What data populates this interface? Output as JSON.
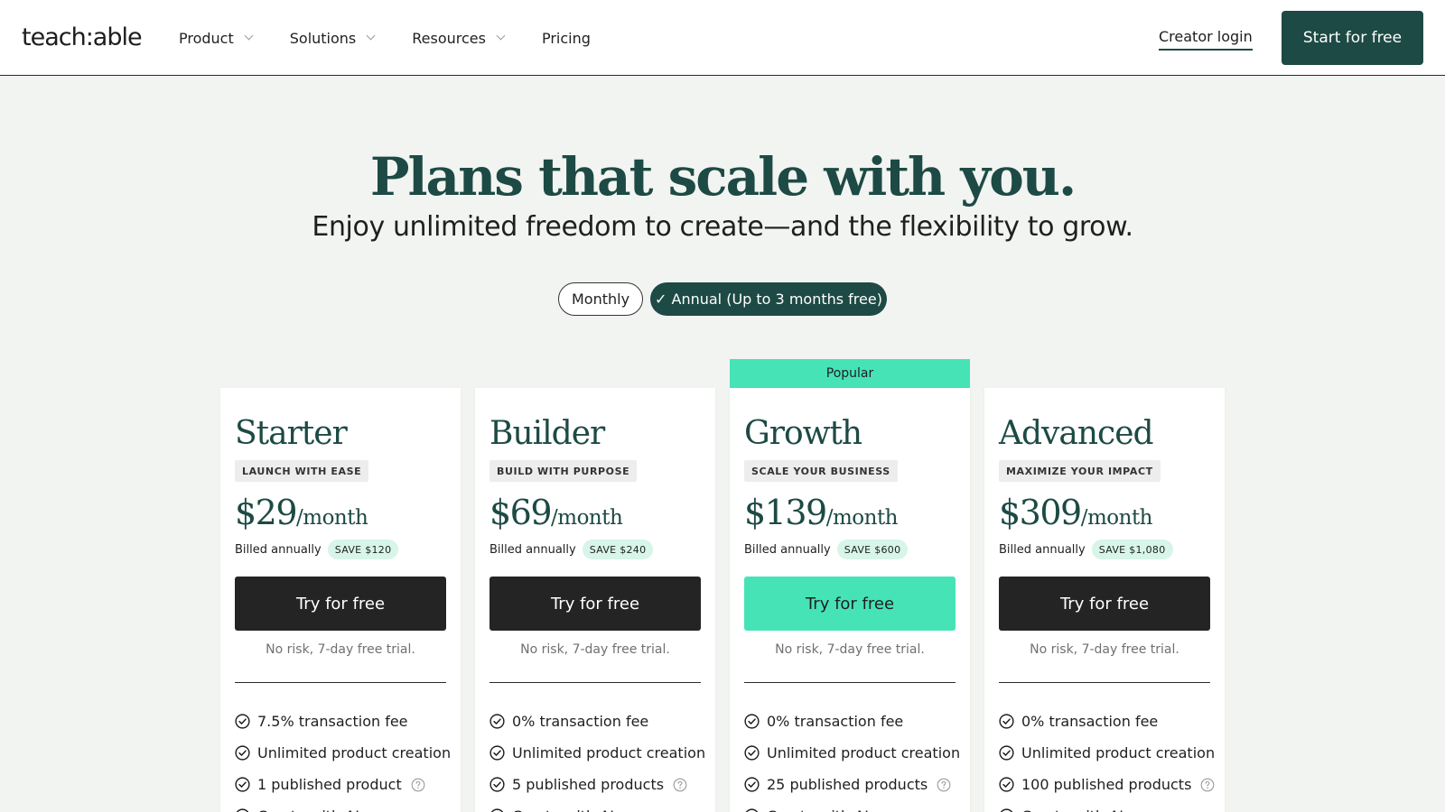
{
  "header": {
    "logo": "teach:able",
    "nav": [
      {
        "label": "Product"
      },
      {
        "label": "Solutions"
      },
      {
        "label": "Resources"
      },
      {
        "label": "Pricing"
      }
    ],
    "creator_login": "Creator login",
    "start_button": "Start for free"
  },
  "hero": {
    "title": "Plans that scale with you.",
    "subtitle": "Enjoy unlimited freedom to create—and the flexibility to grow."
  },
  "billing_toggle": {
    "monthly": "Monthly",
    "annual": "✓ Annual (Up to 3 months free)",
    "selected": "annual"
  },
  "popular_label": "Popular",
  "colors": {
    "brand": "#1d4a44",
    "accent": "#46e3b6",
    "background": "#f2f4f1"
  },
  "plans": [
    {
      "name": "Starter",
      "tagline": "LAUNCH WITH EASE",
      "price": "$29",
      "period": "/month",
      "billed": "Billed annually",
      "save": "SAVE $120",
      "cta": "Try for free",
      "trial": "No risk, 7-day free trial.",
      "features": [
        "7.5% transaction fee",
        "Unlimited product creation",
        "1 published product",
        "Create with AI"
      ]
    },
    {
      "name": "Builder",
      "tagline": "BUILD WITH PURPOSE",
      "price": "$69",
      "period": "/month",
      "billed": "Billed annually",
      "save": "SAVE $240",
      "cta": "Try for free",
      "trial": "No risk, 7-day free trial.",
      "features": [
        "0% transaction fee",
        "Unlimited product creation",
        "5 published products",
        "Create with AI"
      ]
    },
    {
      "name": "Growth",
      "tagline": "SCALE YOUR BUSINESS",
      "price": "$139",
      "period": "/month",
      "billed": "Billed annually",
      "save": "SAVE $600",
      "cta": "Try for free",
      "trial": "No risk, 7-day free trial.",
      "features": [
        "0% transaction fee",
        "Unlimited product creation",
        "25 published products",
        "Create with AI"
      ]
    },
    {
      "name": "Advanced",
      "tagline": "MAXIMIZE YOUR IMPACT",
      "price": "$309",
      "period": "/month",
      "billed": "Billed annually",
      "save": "SAVE $1,080",
      "cta": "Try for free",
      "trial": "No risk, 7-day free trial.",
      "features": [
        "0% transaction fee",
        "Unlimited product creation",
        "100 published products",
        "Create with AI"
      ]
    }
  ]
}
